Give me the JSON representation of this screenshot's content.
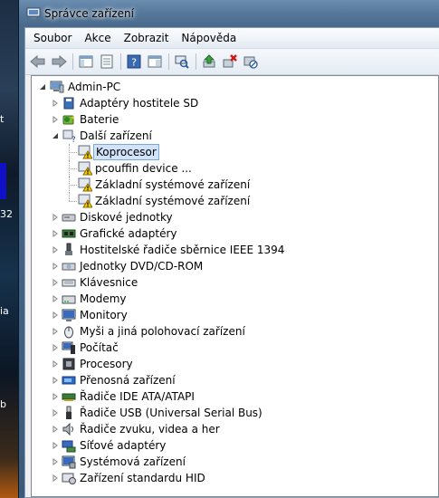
{
  "window": {
    "title": "Správce zařízení"
  },
  "desktop": {
    "snippets": [
      "t",
      "32",
      "ia",
      "b"
    ]
  },
  "menu": [
    "Soubor",
    "Akce",
    "Zobrazit",
    "Nápověda"
  ],
  "toolbar": {
    "buttons": [
      "back-icon",
      "forward-icon",
      "console-tree-icon",
      "properties-icon",
      "help-icon",
      "show-hide-icon",
      "scan-hardware-icon",
      "update-driver-icon",
      "uninstall-icon",
      "disable-icon"
    ]
  },
  "tree": {
    "root": "Admin-PC",
    "categories": [
      {
        "label": "Adaptéry hostitele SD",
        "icon": "sd-host-icon"
      },
      {
        "label": "Baterie",
        "icon": "battery-icon"
      },
      {
        "label": "Další zařízení",
        "icon": "other-devices-icon",
        "expanded": true,
        "children": [
          {
            "label": "Koprocesor",
            "icon": "warning-device-icon",
            "selected": true
          },
          {
            "label": "pcouffin device ...",
            "icon": "warning-device-icon"
          },
          {
            "label": "Základní systémové zařízení",
            "icon": "warning-device-icon"
          },
          {
            "label": "Základní systémové zařízení",
            "icon": "warning-device-icon"
          }
        ]
      },
      {
        "label": "Diskové jednotky",
        "icon": "disk-drive-icon"
      },
      {
        "label": "Grafické adaptéry",
        "icon": "display-adapter-icon"
      },
      {
        "label": "Hostitelské řadiče sběrnice IEEE 1394",
        "icon": "ieee1394-icon"
      },
      {
        "label": "Jednotky DVD/CD-ROM",
        "icon": "dvd-drive-icon"
      },
      {
        "label": "Klávesnice",
        "icon": "keyboard-icon"
      },
      {
        "label": "Modemy",
        "icon": "modem-icon"
      },
      {
        "label": "Monitory",
        "icon": "monitor-icon"
      },
      {
        "label": "Myši a jiná polohovací zařízení",
        "icon": "mouse-icon"
      },
      {
        "label": "Počítač",
        "icon": "computer-icon"
      },
      {
        "label": "Procesory",
        "icon": "processor-icon"
      },
      {
        "label": "Přenosná zařízení",
        "icon": "portable-device-icon"
      },
      {
        "label": "Řadiče IDE ATA/ATAPI",
        "icon": "ide-controller-icon"
      },
      {
        "label": "Řadiče USB (Universal Serial Bus)",
        "icon": "usb-icon"
      },
      {
        "label": "Řadiče zvuku, videa a her",
        "icon": "sound-icon"
      },
      {
        "label": "Síťové adaptéry",
        "icon": "network-adapter-icon"
      },
      {
        "label": "Systémová zařízení",
        "icon": "system-device-icon"
      },
      {
        "label": "Zařízení standardu HID",
        "icon": "hid-icon"
      }
    ]
  }
}
